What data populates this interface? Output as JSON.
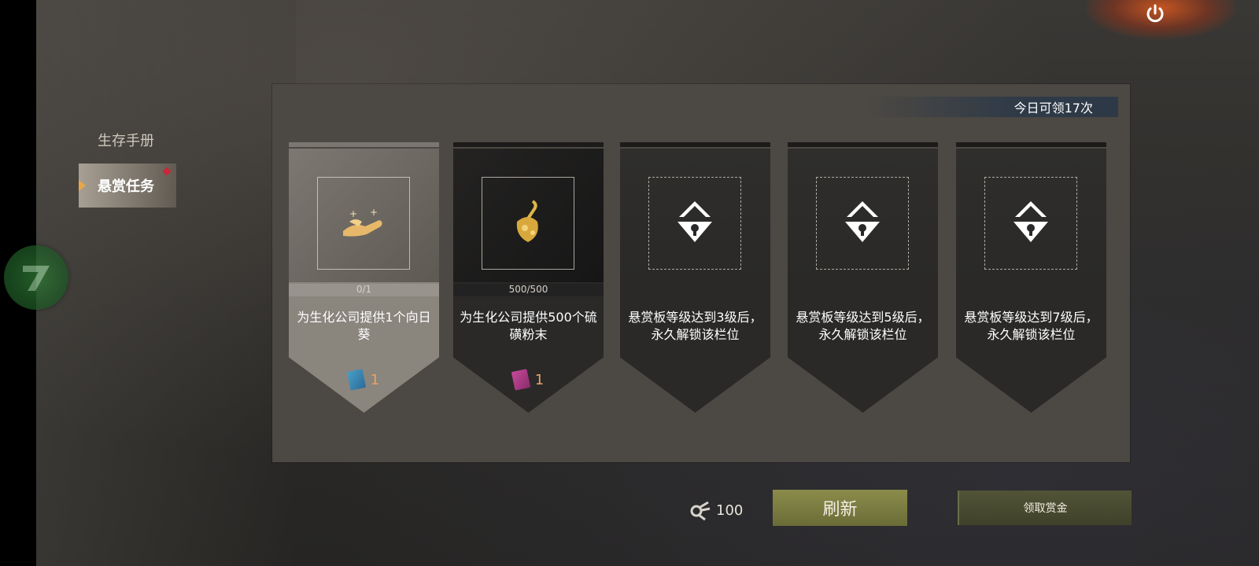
{
  "nav": {
    "items": [
      {
        "label": "生存手册"
      },
      {
        "label": "悬赏任务"
      }
    ]
  },
  "panel": {
    "daily_label": "今日可领17次"
  },
  "cards": [
    {
      "progress": "0/1",
      "desc": "为生化公司提供1个向日葵",
      "reward_qty": "1",
      "reward_icon": "blue-book-icon",
      "item_icon": "sunflower-hands-icon"
    },
    {
      "progress": "500/500",
      "desc": "为生化公司提供500个硫磺粉末",
      "reward_qty": "1",
      "reward_icon": "pink-book-icon",
      "item_icon": "sulfur-powder-icon"
    },
    {
      "desc": "悬赏板等级达到3级后，永久解锁该栏位",
      "icon": "locked-slot-icon"
    },
    {
      "desc": "悬赏板等级达到5级后，永久解锁该栏位",
      "icon": "locked-slot-icon"
    },
    {
      "desc": "悬赏板等级达到7级后，永久解锁该栏位",
      "icon": "locked-slot-icon"
    }
  ],
  "footer": {
    "currency_value": "100",
    "currency_icon": "scrap-parts-icon",
    "refresh_label": "刷新",
    "claim_label": "领取赏金"
  },
  "colors": {
    "accent_orange": "#e7a74a",
    "refresh_green": "#8b8c4a",
    "reward_orange": "#e6a36a",
    "badge_red": "#c7283a"
  }
}
